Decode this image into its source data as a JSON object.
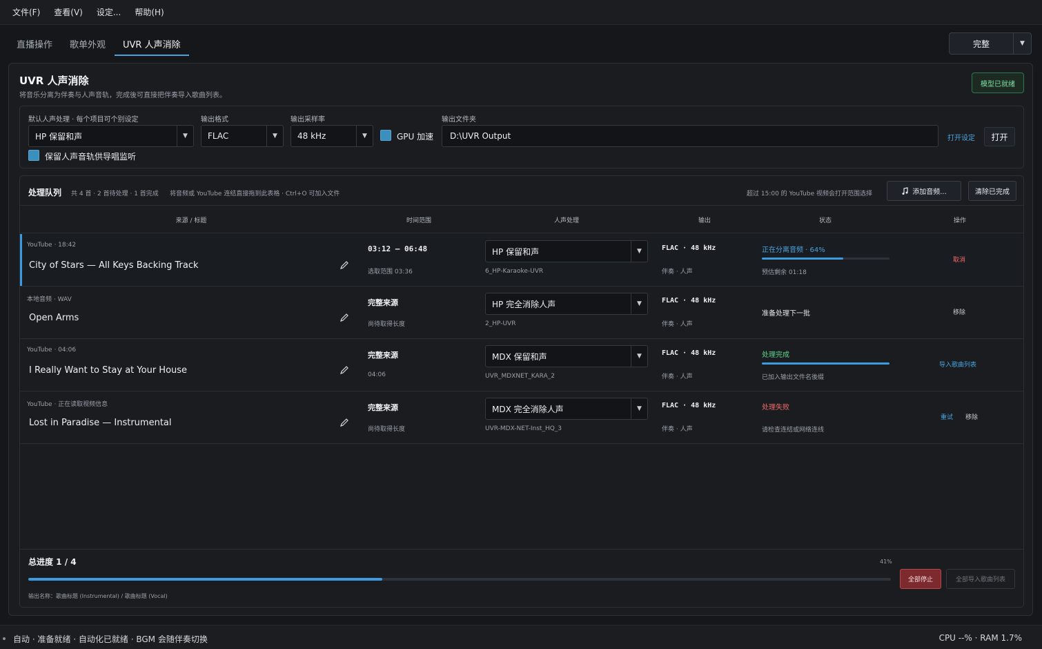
{
  "menu": [
    "文件(F)",
    "查看(V)",
    "设定...",
    "帮助(H)"
  ],
  "tabs": [
    "直播操作",
    "歌单外观",
    "UVR 人声消除"
  ],
  "top_right": {
    "mode_label": "完整"
  },
  "panel": {
    "title": "UVR 人声消除",
    "subtitle": "将音乐分离为伴奏与人声音轨，完成後可直接把伴奏导入歌曲列表。",
    "model_status": "模型已就绪"
  },
  "settings": {
    "vocal_label": "默认人声处理 · 每个项目可个别设定",
    "vocal_value": "HP 保留和声",
    "format_label": "输出格式",
    "format_value": "FLAC",
    "rate_label": "输出采样率",
    "rate_value": "48 kHz",
    "gpu_label": "GPU 加速",
    "folder_label": "输出文件夹",
    "folder_value": "D:\\UVR Output",
    "open_settings": "打开设定",
    "open_button": "打开",
    "keep_vocal_label": "保留人声音轨供导唱监听"
  },
  "queue": {
    "title": "处理队列",
    "count": "共 4 首 · 2 首待处理 · 1 首完成",
    "hint": "将音频或 YouTube 连结直接拖到此表格 · Ctrl+O 可加入文件",
    "right_hint": "超过 15:00 的 YouTube 视频会打开范围选择",
    "add_button": "添加音频...",
    "clear_button": "清除已完成",
    "columns": {
      "source": "来源 / 标题",
      "time": "时间范围",
      "vocal": "人声处理",
      "output": "输出",
      "status": "状态",
      "ops": "操作"
    },
    "rows": [
      {
        "meta": "YouTube · 18:42",
        "title": "City of Stars — All Keys Backing Track",
        "time_main": "03:12 – 06:48",
        "time_sub": "选取范围 03:36",
        "vocal": "HP 保留和声",
        "model": "6_HP-Karaoke-UVR",
        "out_main": "FLAC · 48 kHz",
        "out_sub": "伴奏 · 人声",
        "status": "正在分离音频 · 64%",
        "status_color": "#4aa3df",
        "status_sub": "预估剩余 01:18",
        "progress": 0.64,
        "ops": [
          "取消"
        ]
      },
      {
        "meta": "本地音频 · WAV",
        "title": "Open Arms",
        "time_main": "完整来源",
        "time_sub": "尚待取得长度",
        "vocal": "HP 完全消除人声",
        "model": "2_HP-UVR",
        "out_main": "FLAC · 48 kHz",
        "out_sub": "伴奏 · 人声",
        "status": "准备处理下一批",
        "status_color": "#e6e8eb",
        "status_sub": "",
        "ops": [
          "移除"
        ]
      },
      {
        "meta": "YouTube · 04:06",
        "title": "I Really Want to Stay at Your House",
        "time_main": "完整来源",
        "time_sub": "04:06",
        "vocal": "MDX 保留和声",
        "model": "UVR_MDXNET_KARA_2",
        "out_main": "FLAC · 48 kHz",
        "out_sub": "伴奏 · 人声",
        "status": "处理完成",
        "status_color": "#5fd38d",
        "status_sub": "已加入输出文件名後缀",
        "progress": 1.0,
        "ops": [
          "导入歌曲列表"
        ]
      },
      {
        "meta": "YouTube · 正在读取视频信息",
        "title": "Lost in Paradise — Instrumental",
        "time_main": "完整来源",
        "time_sub": "尚待取得长度",
        "vocal": "MDX 完全消除人声",
        "model": "UVR-MDX-NET-Inst_HQ_3",
        "out_main": "FLAC · 48 kHz",
        "out_sub": "伴奏 · 人声",
        "status": "处理失败",
        "status_color": "#ef6b6b",
        "status_sub": "请检查连结或网络连线",
        "ops": [
          "重试",
          "移除"
        ]
      }
    ]
  },
  "progress": {
    "title": "总进度 1 / 4",
    "percent_text": "41%",
    "value": 0.41,
    "note": "输出名称：歌曲标题 (Instrumental) / 歌曲标题 (Vocal)",
    "stop_all": "全部停止",
    "import_all": "全部导入歌曲列表"
  },
  "statusbar": {
    "left": "自动 · 准备就绪 · 自动化已就绪 · BGM 会随伴奏切换",
    "right": "CPU --% · RAM 1.7%"
  },
  "colors": {
    "accent": "#3a9be0",
    "danger": "#ef6b6b",
    "success": "#5fd38d"
  }
}
